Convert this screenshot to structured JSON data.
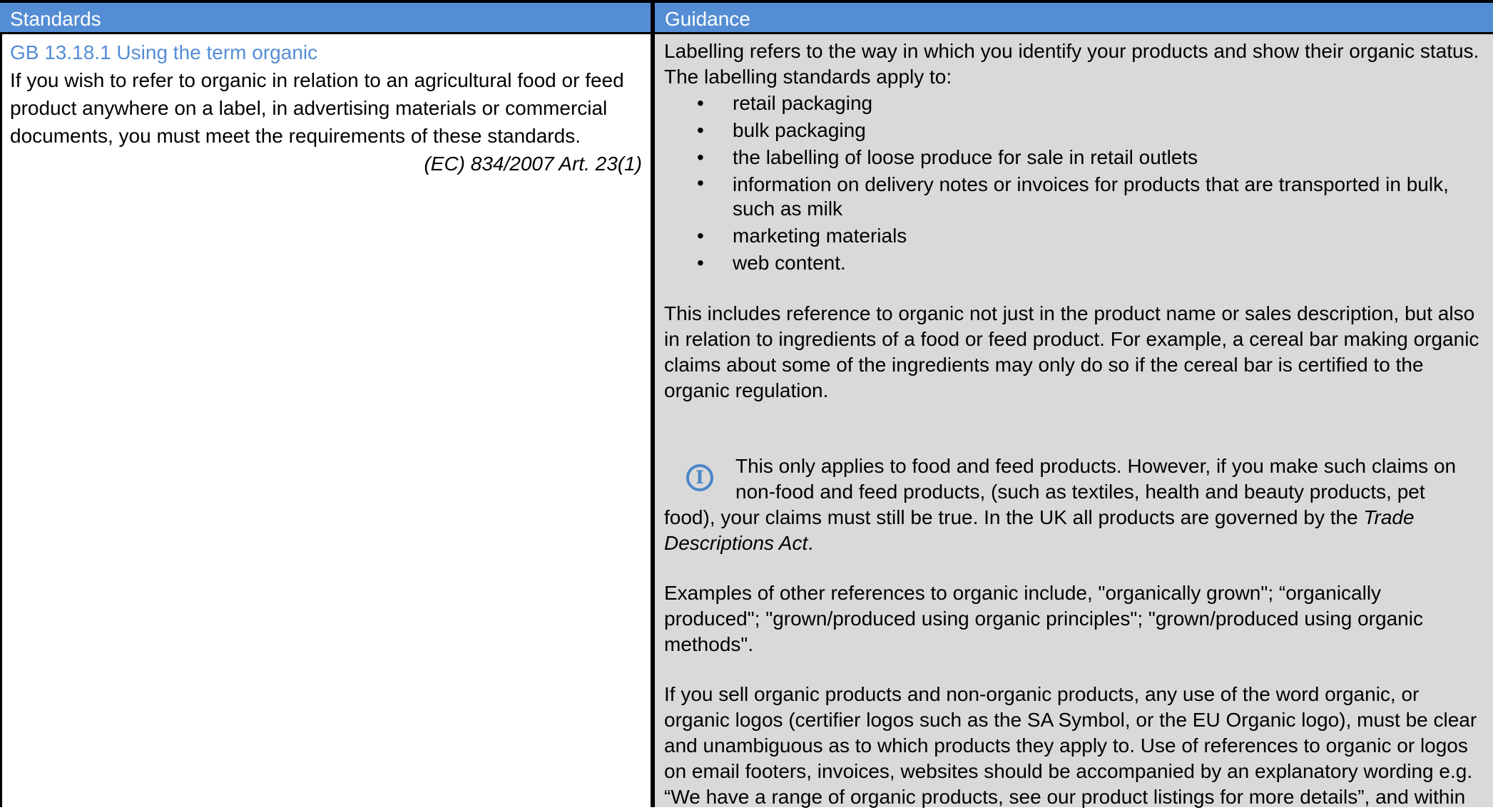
{
  "header": {
    "left_label": "Standards",
    "right_label": "Guidance"
  },
  "standard": {
    "title": "GB 13.18.1 Using the term organic",
    "body_lines": [
      "If you wish to refer to organic in relation to an agricultural food or feed",
      "product anywhere on a label, in advertising materials or commercial",
      "documents, you must meet the requirements of these standards."
    ],
    "reference": "(EC) 834/2007 Art. 23(1)"
  },
  "guidance": {
    "intro_lines": [
      "Labelling refers to the way in which you identify your products and show their organic status.",
      "The labelling standards apply to:"
    ],
    "bullets": [
      {
        "lines": [
          "retail packaging"
        ]
      },
      {
        "lines": [
          "bulk packaging"
        ]
      },
      {
        "lines": [
          "the labelling of loose produce for sale in retail outlets"
        ]
      },
      {
        "lines": [
          "information on delivery notes or invoices for products that are transported in bulk,",
          "such as milk"
        ]
      },
      {
        "lines": [
          "marketing materials"
        ]
      },
      {
        "lines": [
          "web content."
        ]
      }
    ],
    "bullet_symbol": "•",
    "para1_lines": [
      "This includes reference to organic not just in the product name or sales description, but also",
      "in relation to ingredients of a food or feed product. For example, a cereal bar making organic",
      "claims about some of the ingredients may only do so if the cereal bar is certified to the",
      "organic regulation."
    ],
    "note": {
      "icon": "info-icon",
      "icon_glyph": "I",
      "line1": "This only applies to food and feed products. However, if you make such claims on",
      "line2": "non-food and feed products, (such as textiles, health and beauty products, pet",
      "line3": "food), your claims must still be true. In the UK all products are governed by the ",
      "line3_italic": "Trade",
      "line4_italic": "Descriptions Act",
      "line4_end": "."
    },
    "para2_lines": [
      "Examples of other references to organic include, \"organically grown\"; “organically",
      "produced\"; \"grown/produced using organic principles\"; \"grown/produced using organic",
      "methods\"."
    ],
    "para3_lines": [
      "If you sell organic products and non-organic products, any use of the word organic, or",
      "organic logos (certifier logos such as the SA Symbol, or the EU Organic logo), must be clear",
      "and unambiguous as to which products they apply to. Use of references to organic or logos",
      "on email footers, invoices, websites should be accompanied by an explanatory wording e.g.",
      "“We have a range of organic products, see our product listings for more details”, and within"
    ]
  },
  "colors": {
    "header_bg": "#548dd4",
    "title_blue": "#548dd4",
    "guidance_bg": "#d9d9d9",
    "icon_blue": "#4a86c8"
  }
}
